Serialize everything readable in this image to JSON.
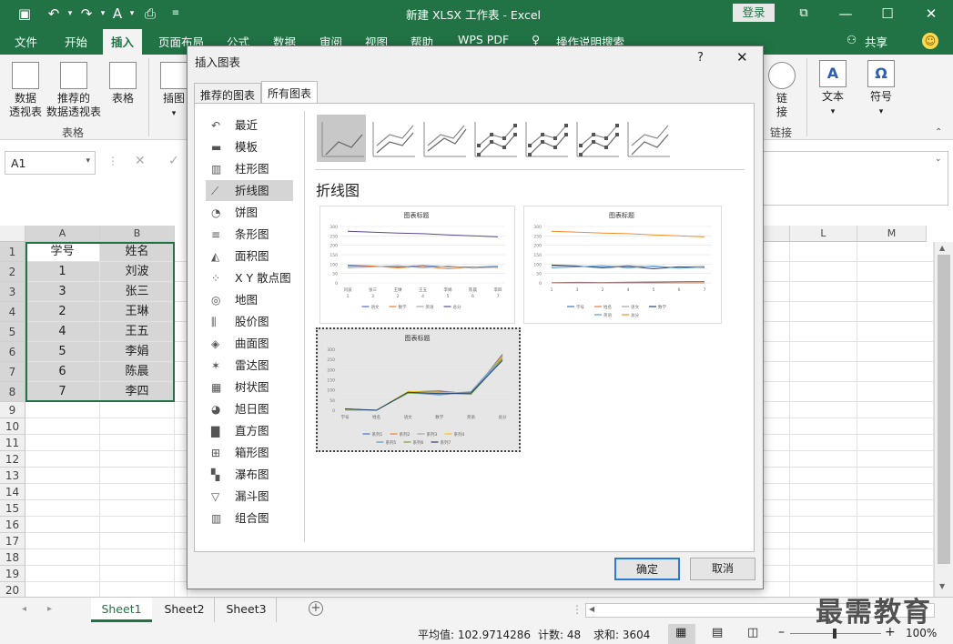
{
  "window": {
    "title": "新建 XLSX 工作表 - Excel",
    "login_label": "登录"
  },
  "ribbon_tabs": [
    "文件",
    "开始",
    "插入",
    "页面布局",
    "公式",
    "数据",
    "审阅",
    "视图",
    "帮助",
    "WPS PDF",
    "操作说明搜索"
  ],
  "share_label": "共享",
  "ribbon": {
    "pivot_label_1": "数据",
    "pivot_label_2": "透视表",
    "rec_pivot_label_1": "推荐的",
    "rec_pivot_label_2": "数据透视表",
    "table_label": "表格",
    "group_tables": "表格",
    "illustrations_label": "插图",
    "link_label_1": "链",
    "link_label_2": "接",
    "group_links": "链接",
    "text_label": "文本",
    "symbol_label": "符号"
  },
  "formula": {
    "name_box": "A1"
  },
  "columns": [
    "A",
    "B",
    "L",
    "M"
  ],
  "rows": [
    "1",
    "2",
    "3",
    "4",
    "5",
    "6",
    "7",
    "8",
    "9",
    "10",
    "11",
    "12",
    "13",
    "14",
    "15",
    "16",
    "17",
    "18",
    "19",
    "20"
  ],
  "table": {
    "headers": [
      "学号",
      "姓名"
    ],
    "rows": [
      [
        "1",
        "刘波"
      ],
      [
        "3",
        "张三"
      ],
      [
        "2",
        "王琳"
      ],
      [
        "4",
        "王五"
      ],
      [
        "5",
        "李娟"
      ],
      [
        "6",
        "陈晨"
      ],
      [
        "7",
        "李四"
      ]
    ]
  },
  "sheets": [
    "Sheet1",
    "Sheet2",
    "Sheet3"
  ],
  "status": {
    "average": "平均值: 102.9714286",
    "count": "计数: 48",
    "sum": "求和: 3604",
    "zoom": "100%"
  },
  "watermark": "最需教育",
  "dialog": {
    "title": "插入图表",
    "help": "?",
    "tabs": [
      "推荐的图表",
      "所有图表"
    ],
    "categories": [
      "最近",
      "模板",
      "柱形图",
      "折线图",
      "饼图",
      "条形图",
      "面积图",
      "X Y 散点图",
      "地图",
      "股价图",
      "曲面图",
      "雷达图",
      "树状图",
      "旭日图",
      "直方图",
      "箱形图",
      "瀑布图",
      "漏斗图",
      "组合图"
    ],
    "section_title": "折线图",
    "preview_title": "图表标题",
    "ok": "确定",
    "cancel": "取消"
  },
  "chart_previews": [
    {
      "type": "line",
      "title": "图表标题",
      "ylim": [
        0,
        300
      ],
      "yticks": [
        "300",
        "250",
        "200",
        "150",
        "100",
        "50",
        "0"
      ],
      "categories": [
        "刘波",
        "张三",
        "王琳",
        "王五",
        "李娟",
        "陈晨",
        "李四"
      ],
      "categories_sub": [
        "1",
        "3",
        "2",
        "4",
        "5",
        "6",
        "7"
      ],
      "series": [
        {
          "name": "语文",
          "color": "#4472c4",
          "values": [
            90,
            88,
            85,
            92,
            86,
            84,
            88
          ]
        },
        {
          "name": "数学",
          "color": "#ed7d31",
          "values": [
            95,
            90,
            80,
            88,
            75,
            85,
            82
          ]
        },
        {
          "name": "英语",
          "color": "#a5a5a5",
          "values": [
            80,
            85,
            92,
            80,
            90,
            78,
            84
          ]
        },
        {
          "name": "总分",
          "color": "#5a4a8a",
          "values": [
            275,
            270,
            265,
            262,
            255,
            250,
            245
          ]
        }
      ]
    },
    {
      "type": "line",
      "title": "图表标题",
      "ylim": [
        0,
        300
      ],
      "yticks": [
        "300",
        "250",
        "200",
        "150",
        "100",
        "50",
        "0"
      ],
      "categories": [
        "1",
        "3",
        "2",
        "4",
        "5",
        "6",
        "7"
      ],
      "series": [
        {
          "name": "学号",
          "color": "#4472c4",
          "values": [
            1,
            3,
            2,
            4,
            5,
            6,
            7
          ]
        },
        {
          "name": "姓名",
          "color": "#ed7d31",
          "values": [
            0,
            0,
            0,
            0,
            0,
            0,
            0
          ]
        },
        {
          "name": "语文",
          "color": "#a5a5a5",
          "values": [
            90,
            88,
            85,
            92,
            86,
            84,
            88
          ]
        },
        {
          "name": "数学",
          "color": "#264478",
          "values": [
            95,
            90,
            80,
            88,
            75,
            85,
            82
          ]
        },
        {
          "name": "英语",
          "color": "#5b9bd5",
          "values": [
            80,
            85,
            92,
            80,
            90,
            78,
            84
          ]
        },
        {
          "name": "总分",
          "color": "#f28e2b",
          "values": [
            275,
            270,
            265,
            262,
            255,
            250,
            245
          ]
        }
      ]
    },
    {
      "type": "line",
      "title": "图表标题",
      "ylim": [
        0,
        300
      ],
      "yticks": [
        "300",
        "250",
        "200",
        "150",
        "100",
        "50",
        "0"
      ],
      "categories": [
        "学号",
        "姓名",
        "语文",
        "数学",
        "英语",
        "总分"
      ],
      "series": [
        {
          "name": "系列1",
          "color": "#4472c4",
          "values": [
            1,
            0,
            90,
            95,
            80,
            275
          ]
        },
        {
          "name": "系列2",
          "color": "#ed7d31",
          "values": [
            3,
            0,
            88,
            90,
            85,
            270
          ]
        },
        {
          "name": "系列3",
          "color": "#a5a5a5",
          "values": [
            2,
            0,
            85,
            80,
            92,
            265
          ]
        },
        {
          "name": "系列4",
          "color": "#ffc000",
          "values": [
            4,
            0,
            92,
            88,
            80,
            262
          ]
        },
        {
          "name": "系列5",
          "color": "#5b9bd5",
          "values": [
            5,
            0,
            86,
            75,
            90,
            255
          ]
        },
        {
          "name": "系列6",
          "color": "#70ad47",
          "values": [
            6,
            0,
            84,
            85,
            78,
            250
          ]
        },
        {
          "name": "系列7",
          "color": "#264478",
          "values": [
            7,
            0,
            88,
            82,
            84,
            245
          ]
        }
      ]
    }
  ]
}
